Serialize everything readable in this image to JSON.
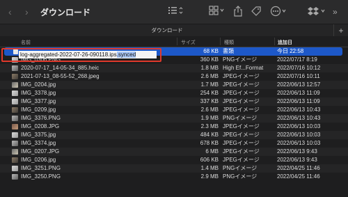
{
  "toolbar": {
    "title": "ダウンロード",
    "back_icon": "chevron-left-icon",
    "forward_icon": "chevron-right-icon"
  },
  "tab": {
    "title": "ダウンロード",
    "plus": "+"
  },
  "columns": {
    "name": "名前",
    "size": "サイズ",
    "kind": "種類",
    "date": "追加日"
  },
  "selected_file": {
    "name_base": "log-aggregated-2022-07-26-090118.ips",
    "name_ext": ".synced",
    "size": "68 KB",
    "kind": "書類",
    "date": "今日 22:58"
  },
  "files": [
    {
      "name": "IMG_0306.PNG",
      "size": "360 KB",
      "kind": "PNGイメージ",
      "date": "2022/07/17 8:19"
    },
    {
      "name": "2020-07-17_14-05-34_885.heic",
      "size": "1.8 MB",
      "kind": "High Ef...Format",
      "date": "2022/07/16 10:12"
    },
    {
      "name": "2021-07-13_08-55-52_268.jpeg",
      "size": "2.6 MB",
      "kind": "JPEGイメージ",
      "date": "2022/07/16 10:11"
    },
    {
      "name": "IMG_0204.jpg",
      "size": "1.7 MB",
      "kind": "JPEGイメージ",
      "date": "2022/06/13 12:57"
    },
    {
      "name": "IMG_3378.jpg",
      "size": "254 KB",
      "kind": "JPEGイメージ",
      "date": "2022/06/13 11:09"
    },
    {
      "name": "IMG_3377.jpg",
      "size": "337 KB",
      "kind": "JPEGイメージ",
      "date": "2022/06/13 11:09"
    },
    {
      "name": "IMG_0209.jpg",
      "size": "2.6 MB",
      "kind": "JPEGイメージ",
      "date": "2022/06/13 10:43"
    },
    {
      "name": "IMG_3376.PNG",
      "size": "1.9 MB",
      "kind": "PNGイメージ",
      "date": "2022/06/13 10:43"
    },
    {
      "name": "IMG_0208.JPG",
      "size": "2.3 MB",
      "kind": "JPEGイメージ",
      "date": "2022/06/13 10:03"
    },
    {
      "name": "IMG_3375.jpg",
      "size": "484 KB",
      "kind": "JPEGイメージ",
      "date": "2022/06/13 10:03"
    },
    {
      "name": "IMG_3374.jpg",
      "size": "678 KB",
      "kind": "JPEGイメージ",
      "date": "2022/06/13 10:03"
    },
    {
      "name": "IMG_0207.JPG",
      "size": "6 MB",
      "kind": "JPEGイメージ",
      "date": "2022/06/13 9:43"
    },
    {
      "name": "IMG_0206.jpg",
      "size": "606 KB",
      "kind": "JPEGイメージ",
      "date": "2022/06/13 9:43"
    },
    {
      "name": "IMG_3251.PNG",
      "size": "1.4 MB",
      "kind": "PNGイメージ",
      "date": "2022/04/25 11:46"
    },
    {
      "name": "IMG_3250.PNG",
      "size": "2.9 MB",
      "kind": "PNGイメージ",
      "date": "2022/04/25 11:46"
    }
  ],
  "colors": {
    "selection": "#1d58c8",
    "highlight_box": "#e0392b"
  }
}
